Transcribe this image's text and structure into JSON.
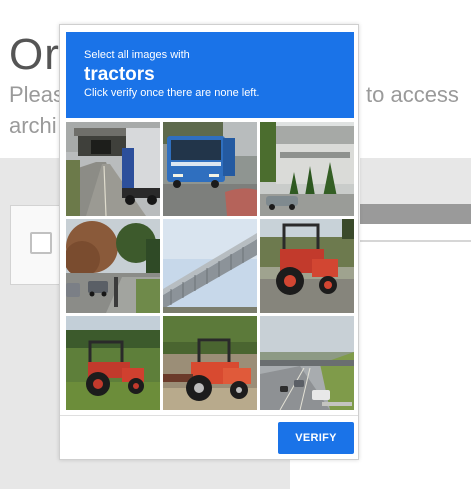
{
  "background_page": {
    "heading": "Or",
    "line1_left": "Pleas",
    "line1_right": "to access",
    "line2": "archi"
  },
  "captcha": {
    "instruction_line1": "Select all images with",
    "target": "tractors",
    "instruction_line2": "Click verify once there are none left.",
    "verify_label": "VERIFY",
    "accent_color": "#1a73e8",
    "tiles": [
      {
        "subject": "highway-tunnel-truck"
      },
      {
        "subject": "blue-bus"
      },
      {
        "subject": "buildings-trees-car"
      },
      {
        "subject": "autumn-street-cars"
      },
      {
        "subject": "bridge"
      },
      {
        "subject": "red-tractor"
      },
      {
        "subject": "red-tractor-field"
      },
      {
        "subject": "red-tractor-dirt"
      },
      {
        "subject": "highway-cars"
      }
    ]
  }
}
